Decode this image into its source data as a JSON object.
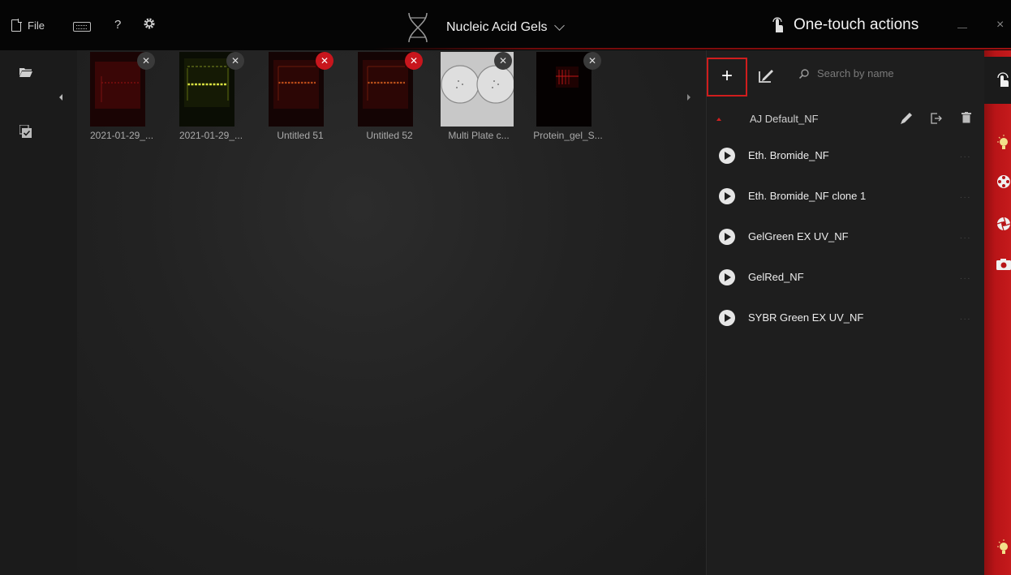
{
  "topbar": {
    "file_label": "File",
    "help_label": "?",
    "title": "Nucleic Acid Gels",
    "one_touch": "One-touch actions",
    "close_label": "×"
  },
  "thumbnails": [
    {
      "caption": "2021-01-29_...",
      "close_color": "#3a3a3a"
    },
    {
      "caption": "2021-01-29_...",
      "close_color": "#3a3a3a"
    },
    {
      "caption": "Untitled 51",
      "close_color": "#c8161d"
    },
    {
      "caption": "Untitled 52",
      "close_color": "#c8161d"
    },
    {
      "caption": "Multi Plate c...",
      "close_color": "#3a3a3a"
    },
    {
      "caption": "Protein_gel_S...",
      "close_color": "#3a3a3a"
    }
  ],
  "panel": {
    "add_label": "+",
    "search_placeholder": "Search by name",
    "group_name": "AJ Default_NF",
    "actions": [
      {
        "label": "Eth. Bromide_NF",
        "more": "..."
      },
      {
        "label": "Eth. Bromide_NF clone 1",
        "more": "..."
      },
      {
        "label": "GelGreen EX UV_NF",
        "more": "..."
      },
      {
        "label": "GelRed_NF",
        "more": "..."
      },
      {
        "label": "SYBR Green EX UV_NF",
        "more": "..."
      }
    ]
  },
  "colors": {
    "accent": "#c8161d",
    "strip": "#b81417"
  }
}
